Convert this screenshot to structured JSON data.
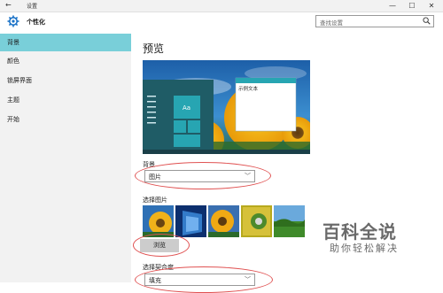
{
  "window": {
    "title": "设置",
    "back_glyph": "←",
    "minimize": "—",
    "maximize": "☐",
    "close": "✕"
  },
  "header": {
    "title": "个性化",
    "icon": "gear-icon",
    "accent": "#1a72c7"
  },
  "search": {
    "placeholder": "查找设置",
    "icon": "search-icon"
  },
  "sidebar": {
    "active_color": "#79cfd9",
    "items": [
      {
        "label": "背景",
        "active": true
      },
      {
        "label": "颜色",
        "active": false
      },
      {
        "label": "锁屏界面",
        "active": false
      },
      {
        "label": "主题",
        "active": false
      },
      {
        "label": "开始",
        "active": false
      }
    ]
  },
  "preview": {
    "heading": "预览",
    "sample_text": "示例文本",
    "tile_label": "Aa"
  },
  "background": {
    "label": "背景",
    "value": "图片"
  },
  "choose_picture": {
    "label": "选择图片",
    "browse_label": "浏览"
  },
  "fit": {
    "label": "选择契合度",
    "value": "填充"
  },
  "watermark": {
    "logo": "百科全说",
    "tagline": "助你轻松解决"
  }
}
